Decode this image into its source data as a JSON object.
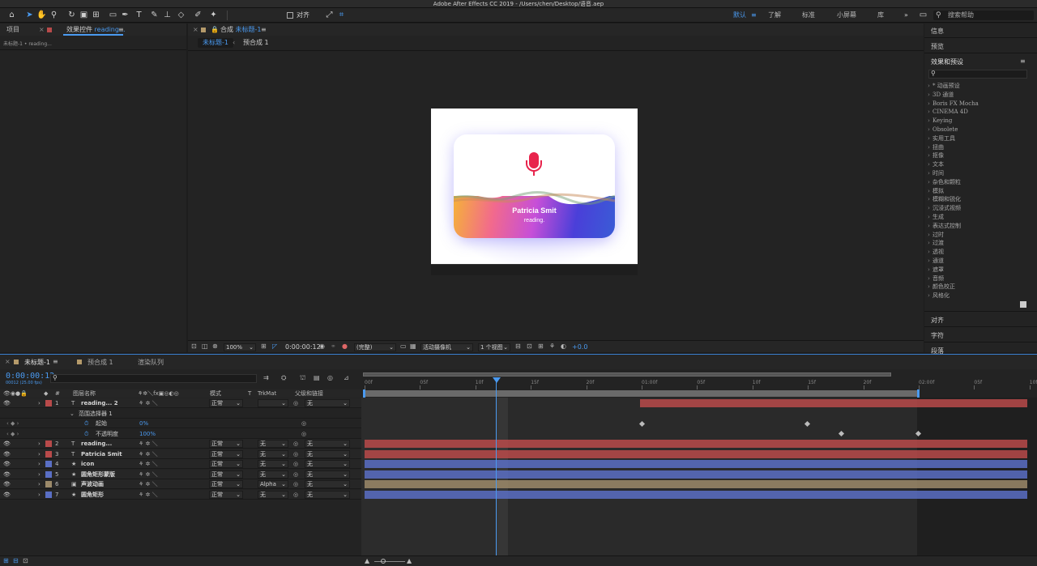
{
  "window": {
    "title": "Adobe After Effects CC 2019 - /Users/chen/Desktop/语音.aep"
  },
  "toolbar": {
    "align_label": "对齐",
    "workspaces": [
      "默认",
      "了解",
      "标准",
      "小屏幕",
      "库"
    ],
    "active_workspace": "默认",
    "search_placeholder": "搜索帮助"
  },
  "left_panel": {
    "tab_project": "项目",
    "tab_effects": "效果控件",
    "tab_effects_layer": "reading...",
    "subtitle": "未标题-1 • reading..."
  },
  "comp_panel": {
    "tab_prefix": "合成",
    "tab_name": "未标题-1",
    "crumbs": [
      "未标题-1",
      "预合成 1"
    ],
    "card_name": "Patricia Smit",
    "card_status": "reading."
  },
  "viewer_bar": {
    "zoom": "100%",
    "timecode": "0:00:00:12",
    "resolution": "(完整)",
    "camera": "活动摄像机",
    "views": "1 个视图",
    "exposure": "+0.0"
  },
  "right_panel": {
    "info": "信息",
    "preview": "预览",
    "effects_presets": "效果和预设",
    "effects_list": [
      "* 动画预设",
      "3D 通道",
      "Boris FX Mocha",
      "CINEMA 4D",
      "Keying",
      "Obsolete",
      "实用工具",
      "扭曲",
      "抠像",
      "文本",
      "时间",
      "杂色和颗粒",
      "模拟",
      "模糊和锐化",
      "沉浸式视频",
      "生成",
      "表达式控制",
      "过时",
      "过渡",
      "透视",
      "通道",
      "遮罩",
      "音频",
      "颜色校正",
      "风格化"
    ],
    "align": "对齐",
    "character": "字符",
    "paragraph": "段落"
  },
  "timeline": {
    "tabs": [
      "未标题-1",
      "预合成 1",
      "渲染队列"
    ],
    "timecode": "0:00:00:12",
    "fps_note": "00012 (25.00 fps)",
    "headers": {
      "num": "#",
      "name": "图层名称",
      "mode": "模式",
      "t": "T",
      "trkmat": "TrkMat",
      "parent": "父级和链接"
    },
    "ruler": [
      "00f",
      "05f",
      "10f",
      "15f",
      "20f",
      "01:00f",
      "05f",
      "10f",
      "15f",
      "20f",
      "02:00f",
      "05f",
      "10f"
    ],
    "layers": [
      {
        "num": "1",
        "type": "T",
        "name": "reading... 2",
        "mode": "正常",
        "trkmat": "",
        "parent": "无",
        "color": "#b84a4a"
      },
      {
        "num": "",
        "type": "",
        "name": "范围选择器 1",
        "sub": true
      },
      {
        "num": "",
        "type": "",
        "name": "起始",
        "value": "0%",
        "sub": true
      },
      {
        "num": "",
        "type": "",
        "name": "不透明度",
        "value": "100%",
        "sub": true
      },
      {
        "num": "2",
        "type": "T",
        "name": "reading...",
        "mode": "正常",
        "trkmat": "无",
        "parent": "无",
        "color": "#b84a4a"
      },
      {
        "num": "3",
        "type": "T",
        "name": "Patricia Smit",
        "mode": "正常",
        "trkmat": "无",
        "parent": "无",
        "color": "#b84a4a"
      },
      {
        "num": "4",
        "type": "★",
        "name": "icon",
        "mode": "正常",
        "trkmat": "无",
        "parent": "无",
        "color": "#5a6fc4"
      },
      {
        "num": "5",
        "type": "★",
        "name": "圆角矩形蒙版",
        "mode": "正常",
        "trkmat": "无",
        "parent": "无",
        "color": "#5a6fc4"
      },
      {
        "num": "6",
        "type": "▣",
        "name": "声波动画",
        "mode": "正常",
        "trkmat": "Alpha",
        "parent": "无",
        "color": "#9c8a6a"
      },
      {
        "num": "7",
        "type": "★",
        "name": "圆角矩形",
        "mode": "正常",
        "trkmat": "无",
        "parent": "无",
        "color": "#5a6fc4"
      }
    ]
  },
  "colors": {
    "accent": "#2d8ceb",
    "red_label": "#b84a4a",
    "blue_label": "#5a6fc4",
    "tan_label": "#9c8a6a",
    "mic": "#e8244c"
  }
}
